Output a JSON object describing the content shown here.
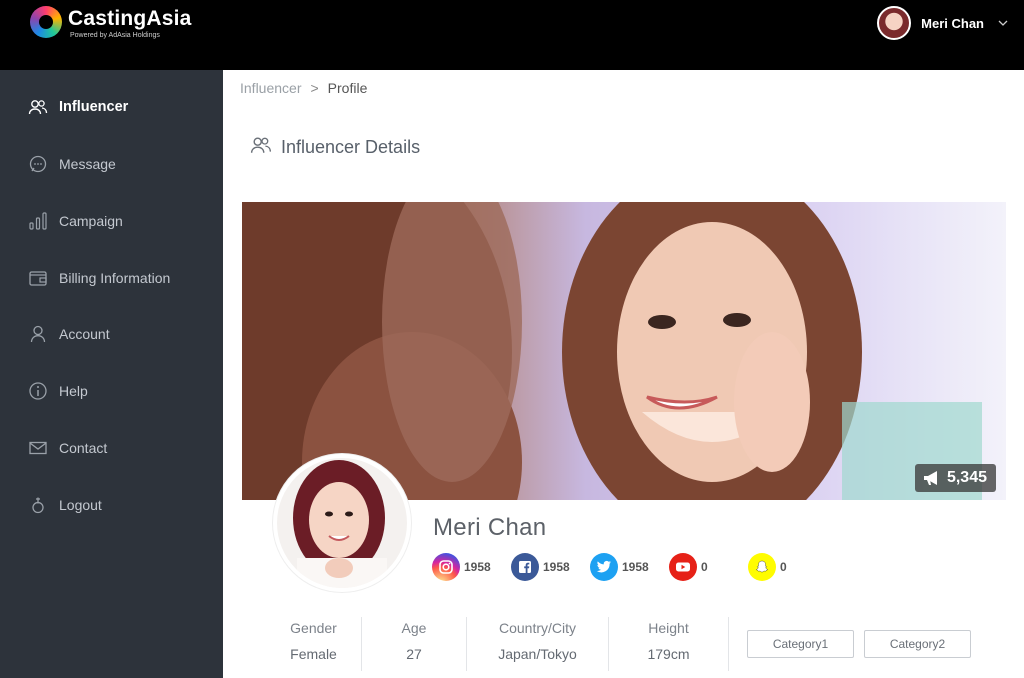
{
  "brand": {
    "name": "CastingAsia",
    "tagline": "Powered by AdAsia Holdings",
    "colors": {
      "topbar": "#000000",
      "sidebar": "#2d333b"
    }
  },
  "user": {
    "name": "Meri Chan",
    "avatar_icon": "user-avatar",
    "menu_icon": "chevron-down-icon"
  },
  "sidebar": {
    "items": [
      {
        "label": "Influencer",
        "icon": "users-icon",
        "active": true
      },
      {
        "label": "Message",
        "icon": "chat-bubble-icon"
      },
      {
        "label": "Campaign",
        "icon": "bar-chart-icon"
      },
      {
        "label": "Billing Information",
        "icon": "wallet-icon"
      },
      {
        "label": "Account",
        "icon": "user-icon"
      },
      {
        "label": "Help",
        "icon": "info-icon"
      },
      {
        "label": "Contact",
        "icon": "mail-icon"
      },
      {
        "label": "Logout",
        "icon": "logout-icon"
      }
    ]
  },
  "breadcrumb": {
    "parent": "Influencer",
    "separator": ">",
    "current": "Profile"
  },
  "section": {
    "title": "Influencer Details",
    "icon": "users-icon"
  },
  "banner": {
    "views": "5,345",
    "views_icon": "megaphone-icon"
  },
  "profile": {
    "name": "Meri Chan",
    "social": [
      {
        "network": "instagram",
        "icon": "instagram-icon",
        "count": "1958",
        "color": "#c13584"
      },
      {
        "network": "facebook",
        "icon": "facebook-icon",
        "count": "1958",
        "color": "#3b5998"
      },
      {
        "network": "twitter",
        "icon": "twitter-icon",
        "count": "1958",
        "color": "#1da1f2"
      },
      {
        "network": "youtube",
        "icon": "youtube-icon",
        "count": "0",
        "color": "#e62117"
      },
      {
        "network": "snapchat",
        "icon": "snapchat-icon",
        "count": "0",
        "color": "#fffc00"
      }
    ],
    "stats": [
      {
        "label": "Gender",
        "value": "Female"
      },
      {
        "label": "Age",
        "value": "27"
      },
      {
        "label": "Country/City",
        "value": "Japan/Tokyo"
      },
      {
        "label": "Height",
        "value": "179cm"
      }
    ],
    "categories": [
      "Category1",
      "Category2"
    ]
  }
}
